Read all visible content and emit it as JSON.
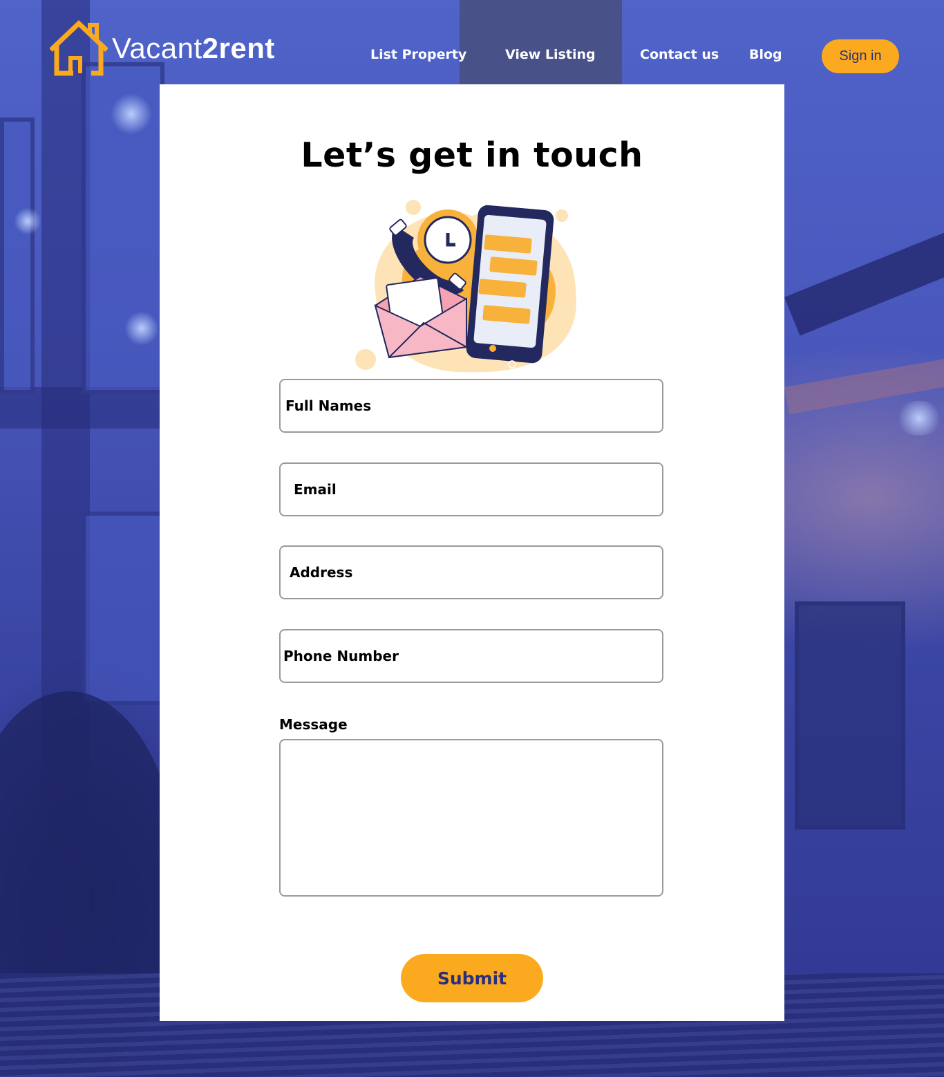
{
  "brand": {
    "name_light": "Vacant",
    "name_bold": "2rent",
    "logo_icon": "house-outline-icon",
    "accent_color": "#fbaa1f",
    "navy_color": "#2a2f7d"
  },
  "nav": {
    "items": [
      {
        "label": "List Property"
      },
      {
        "label": "View Listing"
      },
      {
        "label": "Contact us"
      },
      {
        "label": "Blog"
      }
    ],
    "signin_label": "Sign in"
  },
  "contact_form": {
    "title": "Let’s get in touch",
    "illustration": "contact-communication-illustration",
    "fields": {
      "full_names": "Full Names",
      "email": "Email",
      "address": "Address",
      "phone": "Phone Number"
    },
    "message_label": "Message",
    "message_value": "",
    "submit_label": "Submit"
  }
}
